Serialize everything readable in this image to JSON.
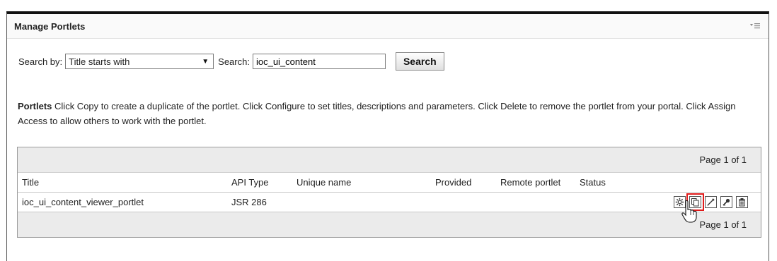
{
  "portlet": {
    "title": "Manage Portlets"
  },
  "search": {
    "by_label": "Search by:",
    "by_value": "Title starts with",
    "search_label": "Search:",
    "query": "ioc_ui_content",
    "button": "Search"
  },
  "description": {
    "heading": "Portlets",
    "text": "Click Copy to create a duplicate of the portlet. Click Configure to set titles, descriptions and parameters. Click Delete to remove the portlet from your portal. Click Assign Access to allow others to work with the portlet."
  },
  "table": {
    "pager_top": "Page 1 of 1",
    "pager_bottom": "Page 1 of 1",
    "columns": [
      "Title",
      "API Type",
      "Unique name",
      "Provided",
      "Remote portlet",
      "Status"
    ],
    "rows": [
      {
        "title": "ioc_ui_content_viewer_portlet",
        "api_type": "JSR 286",
        "unique_name": "",
        "provided": "",
        "remote": "",
        "status": ""
      }
    ],
    "actions": [
      "configure-icon",
      "copy-icon",
      "edit-icon",
      "assign-access-icon",
      "delete-icon"
    ]
  },
  "colors": {
    "highlight": "#e01b1b"
  }
}
